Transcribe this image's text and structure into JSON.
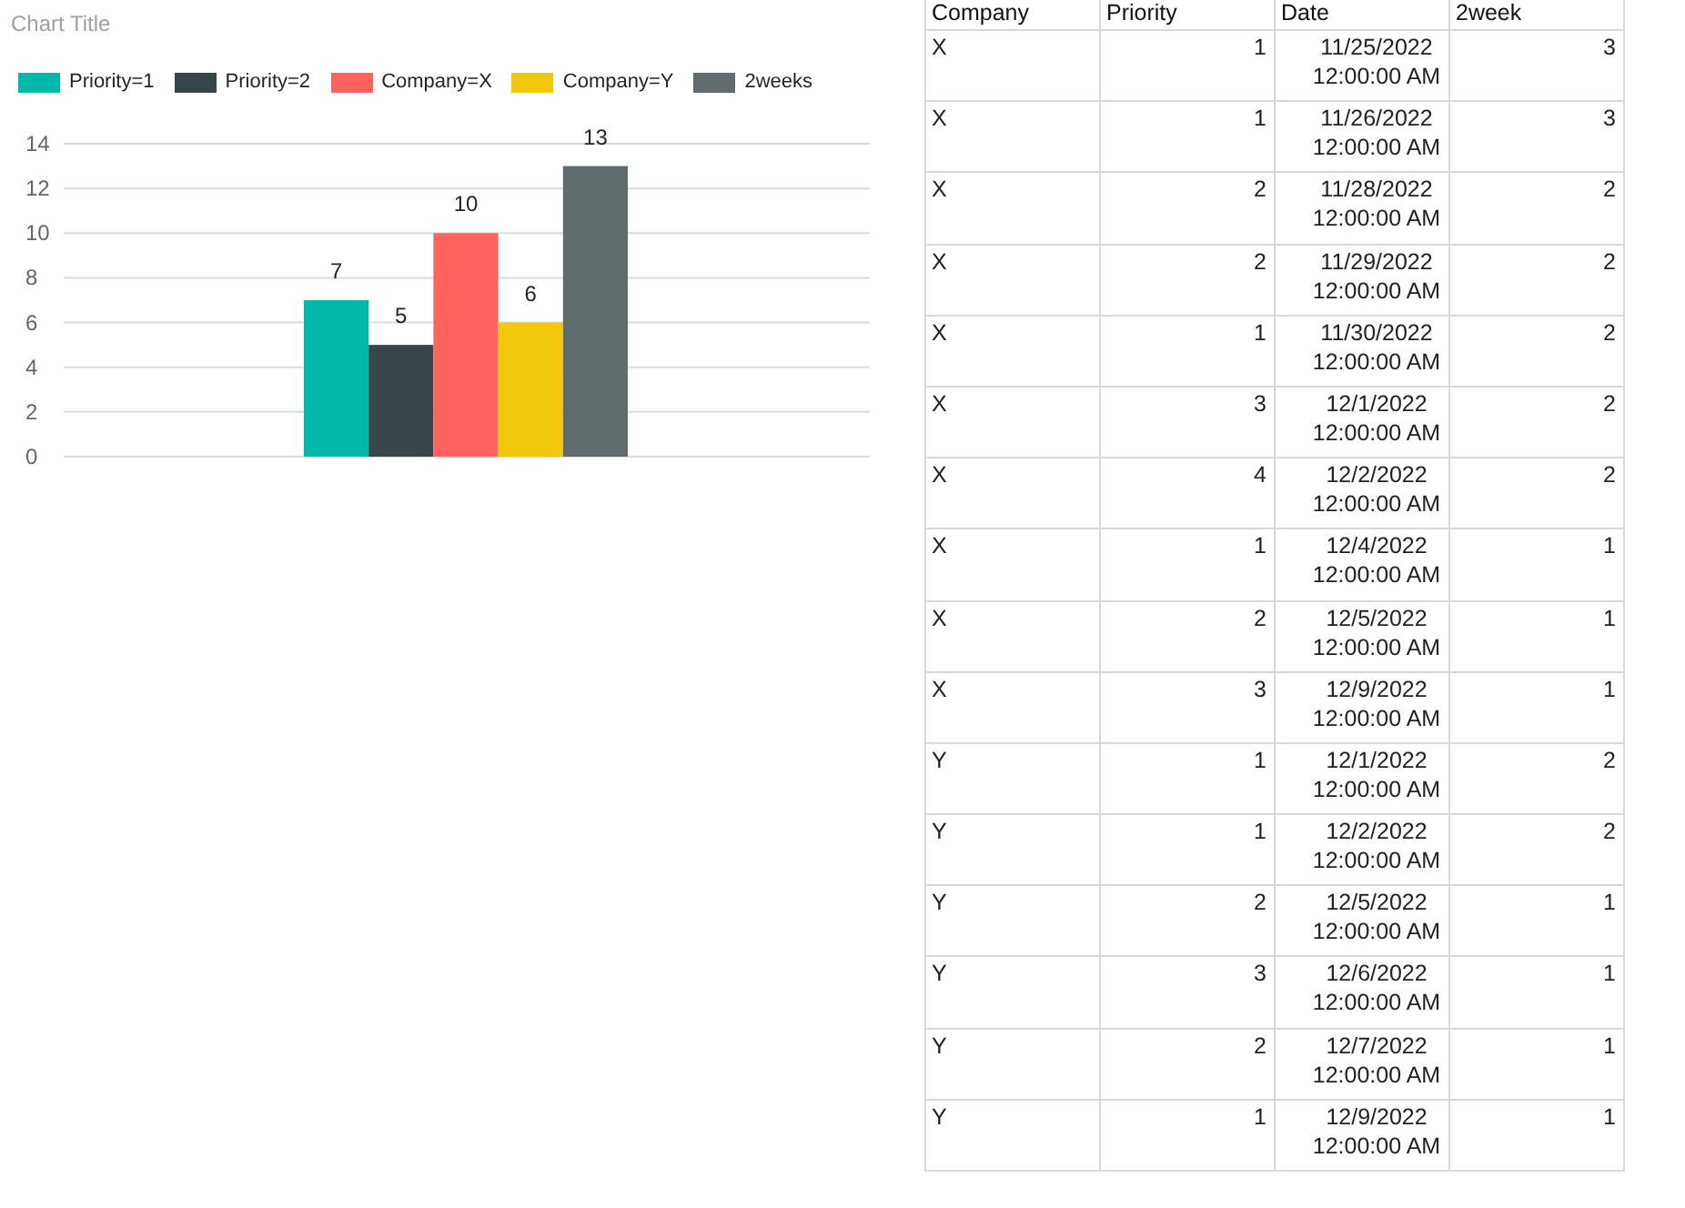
{
  "chart": {
    "chart_data": {
      "type": "bar",
      "title": "Chart Title",
      "grid": true,
      "ylim": [
        0,
        14
      ],
      "yticks": [
        0,
        2,
        4,
        6,
        8,
        10,
        12,
        14
      ],
      "data_labels": true,
      "series": [
        {
          "name": "Priority=1",
          "color": "#01b8aa",
          "values": [
            7
          ]
        },
        {
          "name": "Priority=2",
          "color": "#374649",
          "values": [
            5
          ]
        },
        {
          "name": "Company=X",
          "color": "#fd625e",
          "values": [
            10
          ]
        },
        {
          "name": "Company=Y",
          "color": "#f2c80f",
          "values": [
            6
          ]
        },
        {
          "name": "2weeks",
          "color": "#5f6b6d",
          "values": [
            13
          ]
        }
      ]
    }
  },
  "table": {
    "columns": [
      "Company",
      "Priority",
      "Date",
      "2week"
    ],
    "rows": [
      [
        "X",
        "1",
        "11/25/2022 12:00:00 AM",
        "3"
      ],
      [
        "X",
        "1",
        "11/26/2022 12:00:00 AM",
        "3"
      ],
      [
        "X",
        "2",
        "11/28/2022 12:00:00 AM",
        "2"
      ],
      [
        "X",
        "2",
        "11/29/2022 12:00:00 AM",
        "2"
      ],
      [
        "X",
        "1",
        "11/30/2022 12:00:00 AM",
        "2"
      ],
      [
        "X",
        "3",
        "12/1/2022 12:00:00 AM",
        "2"
      ],
      [
        "X",
        "4",
        "12/2/2022 12:00:00 AM",
        "2"
      ],
      [
        "X",
        "1",
        "12/4/2022 12:00:00 AM",
        "1"
      ],
      [
        "X",
        "2",
        "12/5/2022 12:00:00 AM",
        "1"
      ],
      [
        "X",
        "3",
        "12/9/2022 12:00:00 AM",
        "1"
      ],
      [
        "Y",
        "1",
        "12/1/2022 12:00:00 AM",
        "2"
      ],
      [
        "Y",
        "1",
        "12/2/2022 12:00:00 AM",
        "2"
      ],
      [
        "Y",
        "2",
        "12/5/2022 12:00:00 AM",
        "1"
      ],
      [
        "Y",
        "3",
        "12/6/2022 12:00:00 AM",
        "1"
      ],
      [
        "Y",
        "2",
        "12/7/2022 12:00:00 AM",
        "1"
      ],
      [
        "Y",
        "1",
        "12/9/2022 12:00:00 AM",
        "1"
      ]
    ]
  }
}
